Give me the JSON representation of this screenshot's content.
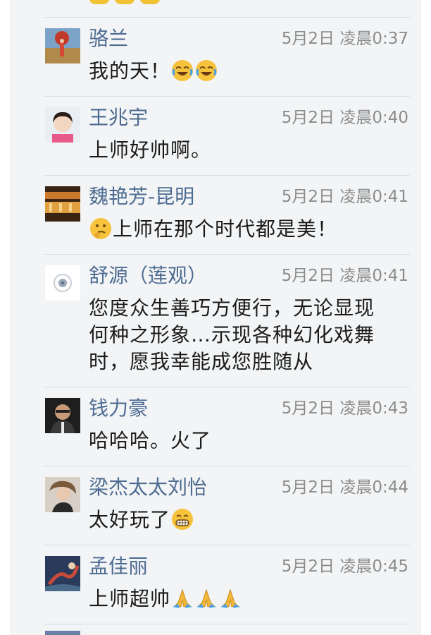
{
  "comments": [
    {
      "name": "骆兰",
      "time": "5月2日 凌晨0:37",
      "text": "我的天！",
      "emojis": [
        "laugh-crying-emoji",
        "laugh-crying-emoji"
      ]
    },
    {
      "name": "王兆宇",
      "time": "5月2日 凌晨0:40",
      "text": "上师好帅啊。"
    },
    {
      "name": "魏艳芳-昆明",
      "time": "5月2日 凌晨0:41",
      "text": "上师在那个时代都是美！",
      "lead_emoji": "thinking-emoji"
    },
    {
      "name": "舒源（莲观）",
      "time": "5月2日 凌晨0:41",
      "text_lines": [
        "您度众生善巧方便行，无论显现",
        "何种之形象…示现各种幻化戏舞",
        "时，愿我幸能成您胜随从"
      ]
    },
    {
      "name": "钱力豪",
      "time": "5月2日 凌晨0:43",
      "text": "哈哈哈。火了"
    },
    {
      "name": "梁杰太太刘怡",
      "time": "5月2日 凌晨0:44",
      "text": "太好玩了",
      "emojis": [
        "grin-emoji"
      ]
    },
    {
      "name": "孟佳丽",
      "time": "5月2日 凌晨0:45",
      "text": "上师超帅",
      "emojis": [
        "folded-hands-emoji",
        "folded-hands-emoji",
        "folded-hands-emoji"
      ]
    }
  ],
  "colors": {
    "panel_background": "#f2f4f6",
    "name": "#4d6b91",
    "time": "#8c8c8c",
    "text": "#1a1a1a",
    "divider": "#d9dde1"
  }
}
